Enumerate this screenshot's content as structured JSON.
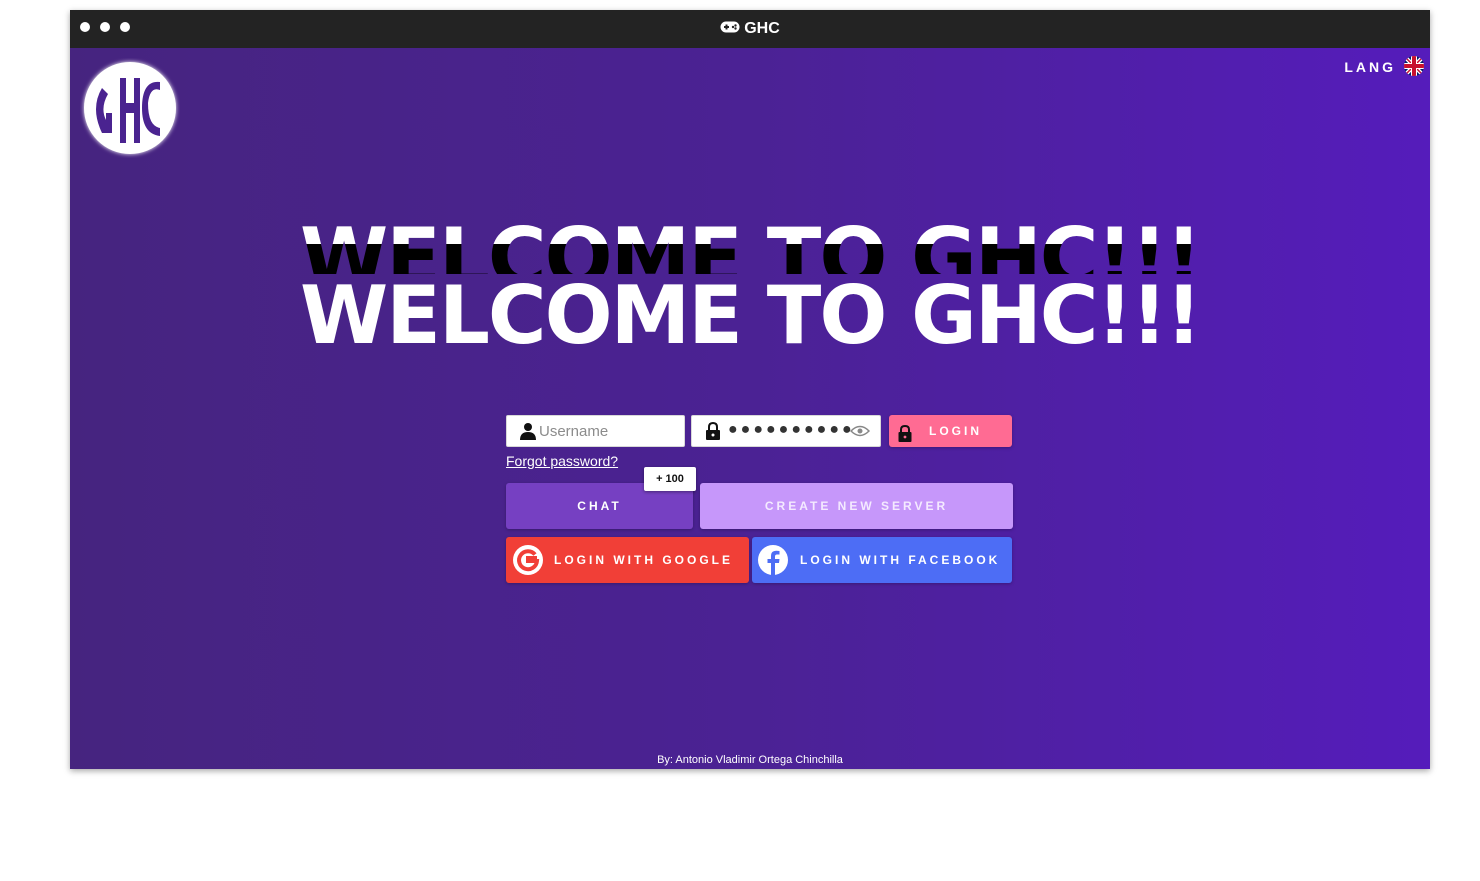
{
  "window": {
    "title": "GHC",
    "title_icon": "gamepad-icon"
  },
  "header": {
    "lang_label": "LANG",
    "lang_flag": "uk-flag-icon"
  },
  "hero": {
    "headline": "WELCOME TO GHC!!!"
  },
  "login": {
    "username_placeholder": "Username",
    "password_value": "●●●●●●●●●●",
    "login_label": "LOGIN",
    "forgot_label": " Forgot password?"
  },
  "actions": {
    "chat_label": "CHAT",
    "chat_badge": "+ 100",
    "create_server_label": "CREATE NEW SERVER",
    "google_label": "LOGIN WITH GOOGLE",
    "facebook_label": "LOGIN WITH FACEBOOK"
  },
  "footer": {
    "credit": "By: Antonio Vladimir Ortega Chinchilla"
  },
  "colors": {
    "titlebar": "#232323",
    "bg_left": "#46247f",
    "bg_right": "#551cbb",
    "login_btn": "#ff6b93",
    "chat_btn": "#7640c2",
    "create_btn": "#c697fa",
    "google_btn": "#f13f37",
    "facebook_btn": "#4d6df5"
  }
}
